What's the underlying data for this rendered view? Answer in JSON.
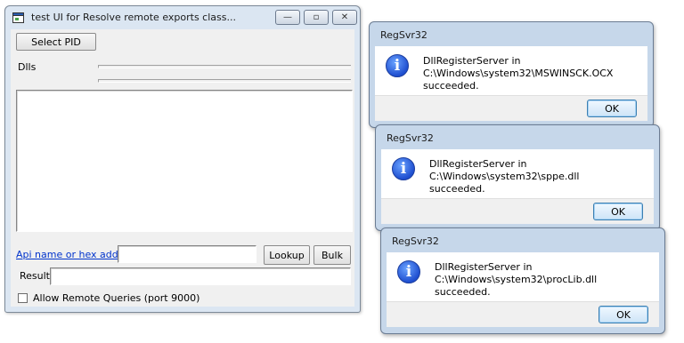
{
  "main_window": {
    "title": "test UI for Resolve remote exports class...",
    "controls": {
      "minimize": "—",
      "maximize": "▫",
      "close": "✕"
    },
    "select_pid_label": "Select PID",
    "dlls_label": "Dlls",
    "api_link": "Api name or hex address",
    "api_input_value": "",
    "lookup_label": "Lookup",
    "bulk_label": "Bulk",
    "result_label": "Result",
    "result_value": "",
    "allow_remote_label": "Allow Remote Queries (port 9000)"
  },
  "dialogs": [
    {
      "title": "RegSvr32",
      "message_line1": "DllRegisterServer in",
      "message_line2": "C:\\Windows\\system32\\MSWINSCK.OCX succeeded.",
      "ok_label": "OK"
    },
    {
      "title": "RegSvr32",
      "message_line1": "DllRegisterServer in C:\\Windows\\system32\\sppe.dll",
      "message_line2": "succeeded.",
      "ok_label": "OK"
    },
    {
      "title": "RegSvr32",
      "message_line1": "DllRegisterServer in C:\\Windows\\system32\\procLib.dll",
      "message_line2": "succeeded.",
      "ok_label": "OK"
    }
  ],
  "icon_glyphs": {
    "info": "i"
  }
}
